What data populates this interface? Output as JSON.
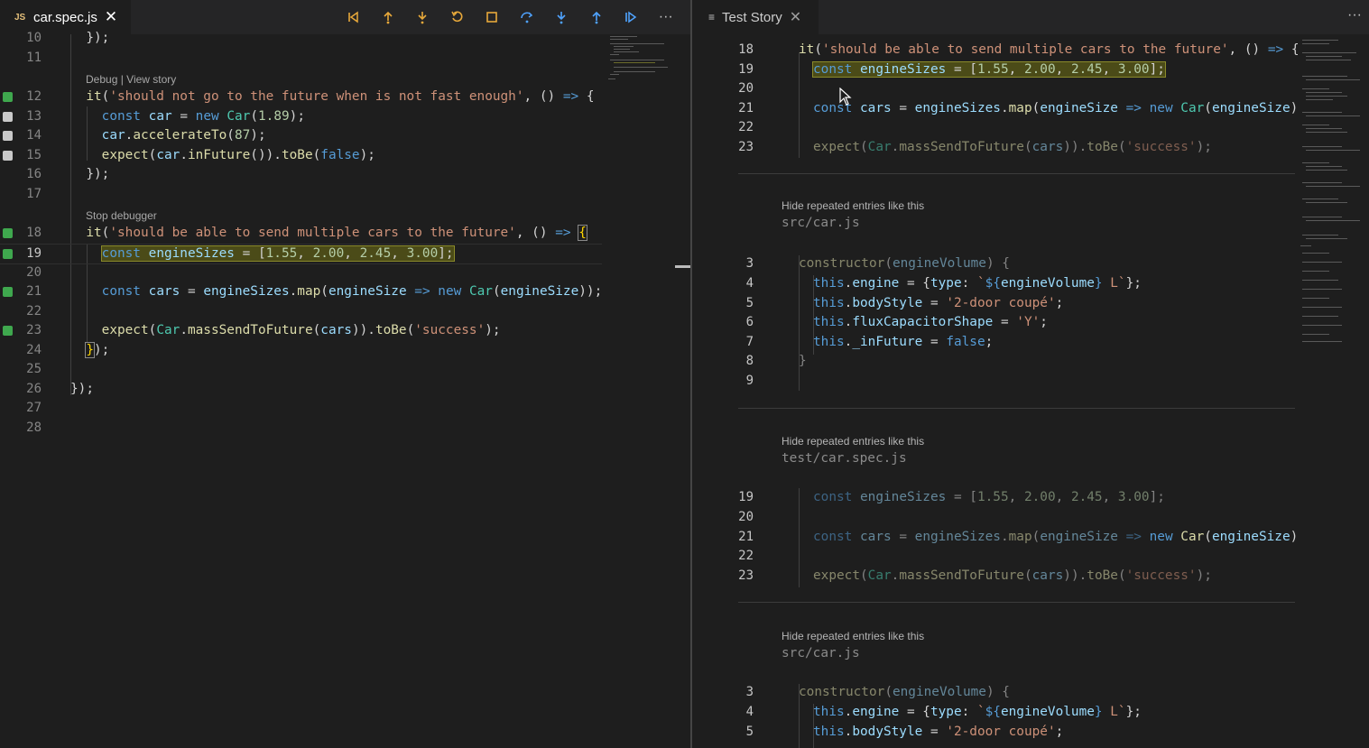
{
  "left": {
    "tab": {
      "icon": "JS",
      "label": "car.spec.js",
      "close": "✕"
    },
    "toolbar": [
      {
        "name": "step-back-icon"
      },
      {
        "name": "step-out-back-icon"
      },
      {
        "name": "step-into-back-icon"
      },
      {
        "name": "restart-icon"
      },
      {
        "name": "stop-icon"
      },
      {
        "name": "step-over-icon"
      },
      {
        "name": "step-into-icon"
      },
      {
        "name": "step-out-icon"
      },
      {
        "name": "continue-icon"
      },
      {
        "name": "more-actions-icon",
        "label": "···"
      }
    ],
    "codelens": {
      "debug": "Debug",
      "sep": " | ",
      "view_story": "View story",
      "stop_debugger": "Stop debugger"
    },
    "lines": {
      "n10": "10",
      "n11": "11",
      "n12": "12",
      "n13": "13",
      "n14": "14",
      "n15": "15",
      "n16": "16",
      "n17": "17",
      "n18": "18",
      "n19": "19",
      "n20": "20",
      "n21": "21",
      "n22": "22",
      "n23": "23",
      "n24": "24",
      "n25": "25",
      "n26": "26",
      "n27": "27",
      "n28": "28"
    }
  },
  "right": {
    "tab": {
      "icon": "≡",
      "label": "Test Story",
      "close": "✕"
    },
    "more": "···",
    "hide_repeated": "Hide repeated entries like this",
    "files": {
      "src1": "src/car.js",
      "test": "test/car.spec.js",
      "src2": "src/car.js"
    },
    "nums": {
      "a18": "18",
      "a19": "19",
      "a20": "20",
      "a21": "21",
      "a22": "22",
      "a23": "23",
      "b3": "3",
      "b4": "4",
      "b5": "5",
      "b6": "6",
      "b7": "7",
      "b8": "8",
      "b9": "9",
      "c19": "19",
      "c20": "20",
      "c21": "21",
      "c22": "22",
      "c23": "23",
      "d3": "3",
      "d4": "4",
      "d5": "5"
    }
  },
  "colors": {
    "accent_orange": "#e8a93a",
    "accent_blue": "#4fa3ff",
    "breakpoint_green": "#3fa84e"
  }
}
